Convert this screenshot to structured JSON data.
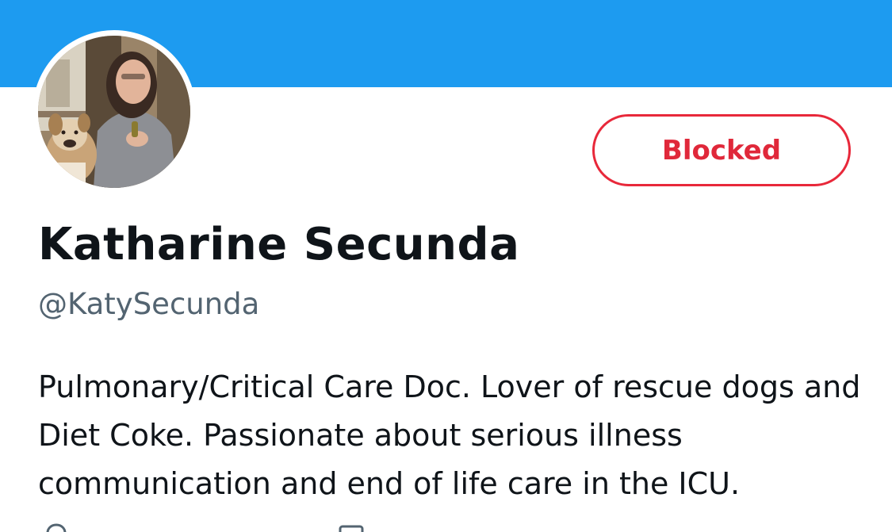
{
  "header": {
    "banner_color": "#1d9bf0"
  },
  "profile": {
    "avatar_icon": "profile-photo",
    "action_button_label": "Blocked",
    "action_button_color": "#e0283a",
    "display_name": "Katharine Secunda",
    "handle": "@KatySecunda",
    "bio": "Pulmonary/Critical Care Doc. Lover of rescue dogs and Diet Coke. Passionate about serious illness communication and end of life care in the ICU."
  },
  "meta": {
    "icons": [
      "location-icon",
      "calendar-icon"
    ]
  }
}
